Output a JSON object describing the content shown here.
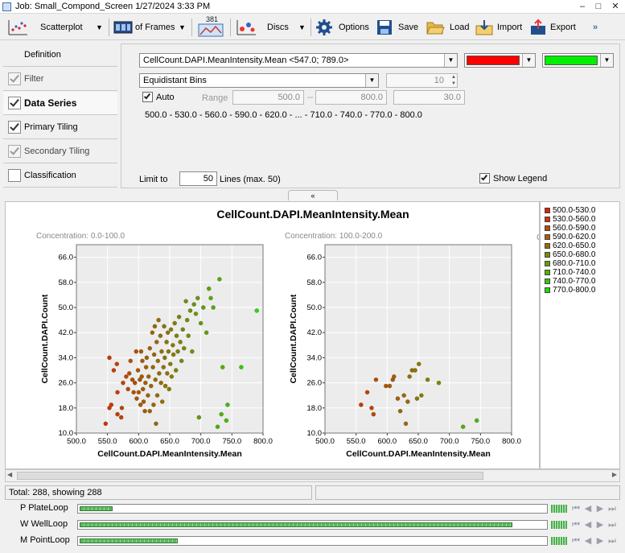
{
  "window": {
    "title": "Job: Small_Compond_Screen 1/27/2024 3:33 PM",
    "controls": [
      "–",
      "□",
      "✕"
    ]
  },
  "toolbar": {
    "scatterplot": "Scatterplot",
    "frames": "of Frames",
    "badge": "381",
    "discs": "Discs",
    "options": "Options",
    "save": "Save",
    "load": "Load",
    "import": "Import",
    "export": "Export",
    "more": "»"
  },
  "nav": {
    "definition": "Definition",
    "filter": "Filter",
    "data_series": "Data Series",
    "primary_tiling": "Primary Tiling",
    "secondary_tiling": "Secondary Tiling",
    "classification": "Classification"
  },
  "settings": {
    "measure": "CellCount.DAPI.MeanIntensity.Mean <547.0; 789.0>",
    "color_start": "#ff0000",
    "color_end": "#00ee00",
    "binning": "Equidistant Bins",
    "bin_count": "10",
    "auto_label": "Auto",
    "range_label": "Range",
    "range_from": "500.0",
    "range_sep": "--",
    "range_to": "800.0",
    "step": "30.0",
    "bins_summary": "500.0 - 530.0 - 560.0 - 590.0 - 620.0 - ... - 710.0 - 740.0 - 770.0 - 800.0",
    "limit_label": "Limit to",
    "limit_value": "50",
    "limit_suffix": "Lines (max. 50)",
    "show_legend": "Show Legend"
  },
  "collapse_tab": "«",
  "chart_data": {
    "type": "scatter",
    "title": "CellCount.DAPI.MeanIntensity.Mean",
    "xlabel": "CellCount.DAPI.MeanIntensity.Mean",
    "ylabel": "CellCount.DAPI.Count",
    "xlim": [
      500,
      800
    ],
    "ylim": [
      10,
      70
    ],
    "xticks": [
      "500.0",
      "550.0",
      "600.0",
      "650.0",
      "700.0",
      "750.0",
      "800.0"
    ],
    "yticks": [
      "10.0",
      "18.0",
      "26.0",
      "34.0",
      "42.0",
      "50.0",
      "58.0",
      "66.0"
    ],
    "color_low": "#ee1100",
    "color_high": "#22dd11",
    "third_panel_stub": "C",
    "panels": [
      {
        "label": "Concentration: 0.0-100.0",
        "points": [
          [
            547,
            13
          ],
          [
            553,
            34
          ],
          [
            556,
            19
          ],
          [
            553,
            18
          ],
          [
            560,
            30
          ],
          [
            565,
            32
          ],
          [
            566,
            23
          ],
          [
            566,
            16
          ],
          [
            573,
            18
          ],
          [
            572,
            15
          ],
          [
            575,
            26
          ],
          [
            580,
            28
          ],
          [
            583,
            24
          ],
          [
            585,
            29
          ],
          [
            587,
            33
          ],
          [
            590,
            27
          ],
          [
            592,
            23
          ],
          [
            594,
            26
          ],
          [
            596,
            36
          ],
          [
            597,
            21
          ],
          [
            599,
            30
          ],
          [
            600,
            23
          ],
          [
            602,
            27
          ],
          [
            603,
            19
          ],
          [
            604,
            36
          ],
          [
            605,
            28
          ],
          [
            606,
            33
          ],
          [
            607,
            24
          ],
          [
            608,
            20
          ],
          [
            610,
            17
          ],
          [
            611,
            26
          ],
          [
            612,
            31
          ],
          [
            613,
            34
          ],
          [
            615,
            22
          ],
          [
            616,
            28
          ],
          [
            618,
            37
          ],
          [
            618,
            17
          ],
          [
            620,
            25
          ],
          [
            622,
            42
          ],
          [
            623,
            31
          ],
          [
            624,
            19
          ],
          [
            625,
            35
          ],
          [
            626,
            44
          ],
          [
            627,
            27
          ],
          [
            628,
            13
          ],
          [
            629,
            39
          ],
          [
            630,
            22
          ],
          [
            631,
            33
          ],
          [
            632,
            46
          ],
          [
            633,
            29
          ],
          [
            635,
            41
          ],
          [
            636,
            26
          ],
          [
            637,
            36
          ],
          [
            638,
            20
          ],
          [
            640,
            31
          ],
          [
            641,
            44
          ],
          [
            642,
            34
          ],
          [
            643,
            25
          ],
          [
            645,
            39
          ],
          [
            646,
            29
          ],
          [
            647,
            42
          ],
          [
            648,
            36
          ],
          [
            649,
            24
          ],
          [
            651,
            32
          ],
          [
            652,
            43
          ],
          [
            653,
            28
          ],
          [
            655,
            38
          ],
          [
            656,
            35
          ],
          [
            658,
            45
          ],
          [
            660,
            30
          ],
          [
            661,
            41
          ],
          [
            663,
            36
          ],
          [
            665,
            47
          ],
          [
            667,
            39
          ],
          [
            669,
            33
          ],
          [
            671,
            43
          ],
          [
            673,
            37
          ],
          [
            676,
            52
          ],
          [
            678,
            46
          ],
          [
            680,
            41
          ],
          [
            683,
            49
          ],
          [
            686,
            36
          ],
          [
            689,
            51
          ],
          [
            692,
            48
          ],
          [
            695,
            53
          ],
          [
            697,
            15
          ],
          [
            700,
            45
          ],
          [
            704,
            50
          ],
          [
            709,
            42
          ],
          [
            713,
            56
          ],
          [
            716,
            53
          ],
          [
            720,
            50
          ],
          [
            727,
            12
          ],
          [
            730,
            59
          ],
          [
            733,
            16
          ],
          [
            735,
            31
          ],
          [
            741,
            14
          ],
          [
            743,
            19
          ],
          [
            765,
            31
          ],
          [
            790,
            49
          ]
        ]
      },
      {
        "label": "Concentration: 100.0-200.0",
        "points": [
          [
            558,
            19
          ],
          [
            568,
            23
          ],
          [
            575,
            18
          ],
          [
            578,
            16
          ],
          [
            582,
            27
          ],
          [
            598,
            25
          ],
          [
            604,
            25
          ],
          [
            609,
            27
          ],
          [
            611,
            28
          ],
          [
            617,
            21
          ],
          [
            621,
            17
          ],
          [
            627,
            22
          ],
          [
            630,
            13
          ],
          [
            633,
            20
          ],
          [
            636,
            28
          ],
          [
            640,
            30
          ],
          [
            645,
            30
          ],
          [
            648,
            21
          ],
          [
            651,
            32
          ],
          [
            655,
            22
          ],
          [
            665,
            27
          ],
          [
            683,
            26
          ],
          [
            722,
            12
          ],
          [
            744,
            14
          ]
        ]
      }
    ]
  },
  "legend": [
    {
      "label": "500.0-530.0",
      "color": "#e02000"
    },
    {
      "label": "530.0-560.0",
      "color": "#d43400"
    },
    {
      "label": "560.0-590.0",
      "color": "#c24800"
    },
    {
      "label": "590.0-620.0",
      "color": "#b05c00"
    },
    {
      "label": "620.0-650.0",
      "color": "#9c6a00"
    },
    {
      "label": "650.0-680.0",
      "color": "#808800"
    },
    {
      "label": "680.0-710.0",
      "color": "#62a000"
    },
    {
      "label": "710.0-740.0",
      "color": "#48b800"
    },
    {
      "label": "740.0-770.0",
      "color": "#30cc00"
    },
    {
      "label": "770.0-800.0",
      "color": "#18e000"
    }
  ],
  "status": {
    "total": "Total: 288, showing 288"
  },
  "loops": [
    {
      "label": "P PlateLoop",
      "progress": 0.07
    },
    {
      "label": "W WellLoop",
      "progress": 0.93
    },
    {
      "label": "M PointLoop",
      "progress": 0.21
    }
  ]
}
